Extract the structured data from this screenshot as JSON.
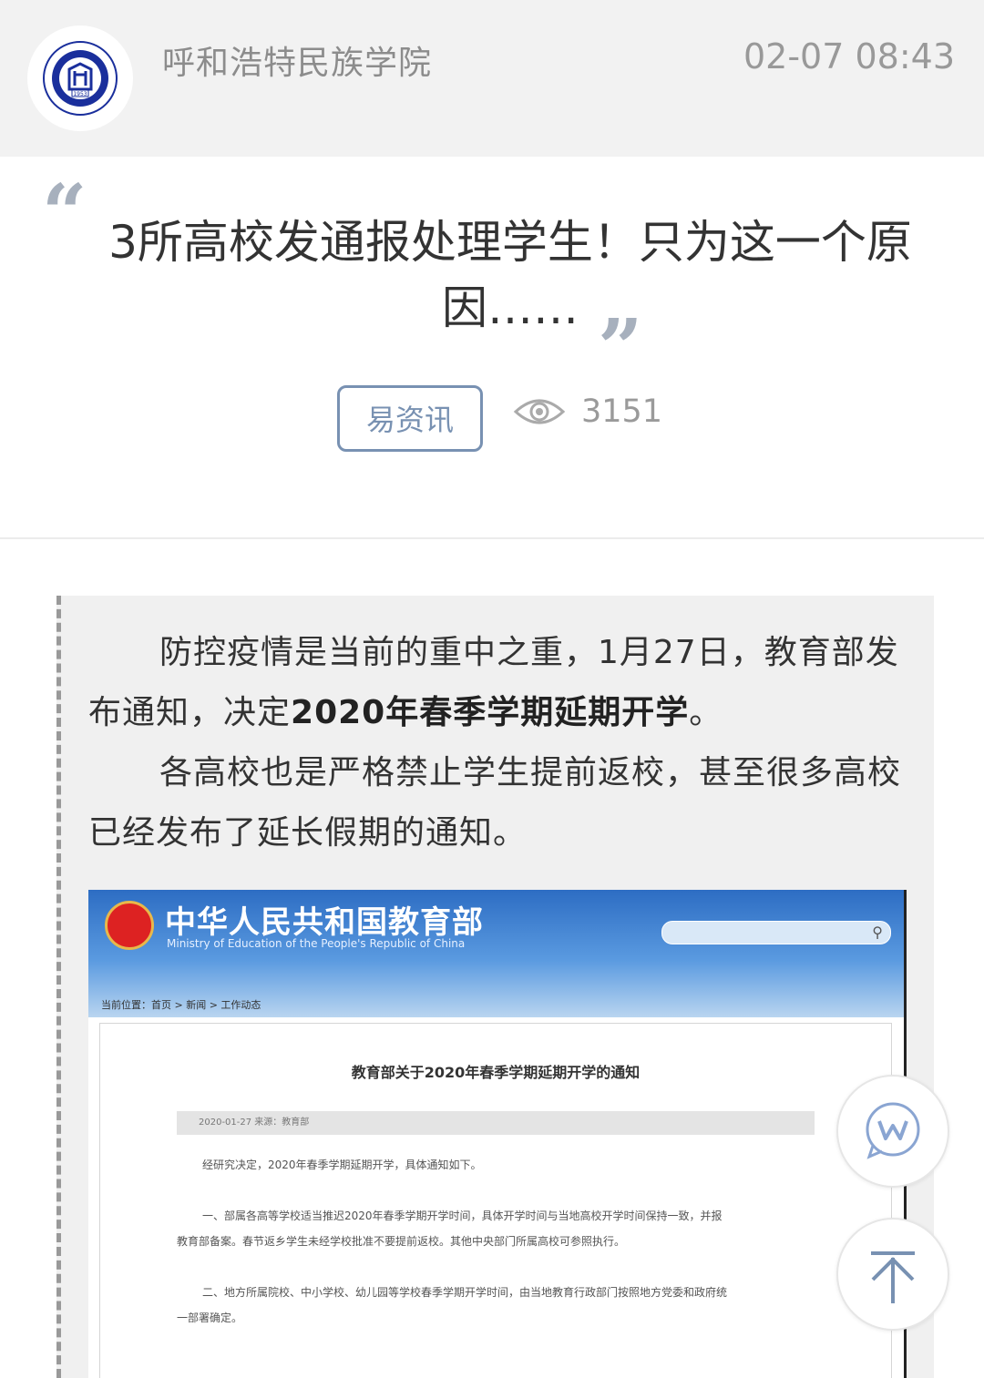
{
  "header": {
    "source_name": "呼和浩特民族学院",
    "timestamp": "02-07 08:43",
    "logo_icon": "college-seal-icon",
    "logo_year": "1953"
  },
  "article": {
    "title": "3所高校发通报处理学生！只为这一个原因……",
    "tag": "易资讯",
    "views": "3151",
    "eye_icon": "eye-icon"
  },
  "body": {
    "p1_text": "防控疫情是当前的重中之重，1月27日，教育部发布通知，决定",
    "p1_bold": "2020年春季学期延期开学",
    "p1_end": "。",
    "p2_text": "各高校也是严格禁止学生提前返校，甚至很多高校已经发布了延长假期的通知。"
  },
  "embedded": {
    "site_title": "中华人民共和国教育部",
    "site_subtitle": "Ministry of Education of the People's Republic of China",
    "breadcrumb": "当前位置：首页 > 新闻 > 工作动态",
    "doc_title": "教育部关于2020年春季学期延期开学的通知",
    "doc_meta": "2020-01-27    来源：教育部",
    "line1": "经研究决定，2020年春季学期延期开学，具体通知如下。",
    "line2": "一、部属各高等学校适当推迟2020年春季学期开学时间，具体开学时间与当地高校开学时间保持一致，并报",
    "line3": "教育部备案。春节返乡学生未经学校批准不要提前返校。其他中央部门所属高校可参照执行。",
    "line4": "二、地方所属院校、中小学校、幼儿园等学校春季学期开学时间，由当地教育行政部门按照地方党委和政府统",
    "line5": "一部署确定。"
  },
  "fab": {
    "w_icon": "w-share-icon",
    "top_icon": "back-to-top-icon"
  },
  "colors": {
    "tag_border": "#7891b2",
    "quote_mark": "#a7b0bd",
    "header_bg": "#f2f2f2",
    "quote_box_bg": "#f0f0f0"
  }
}
